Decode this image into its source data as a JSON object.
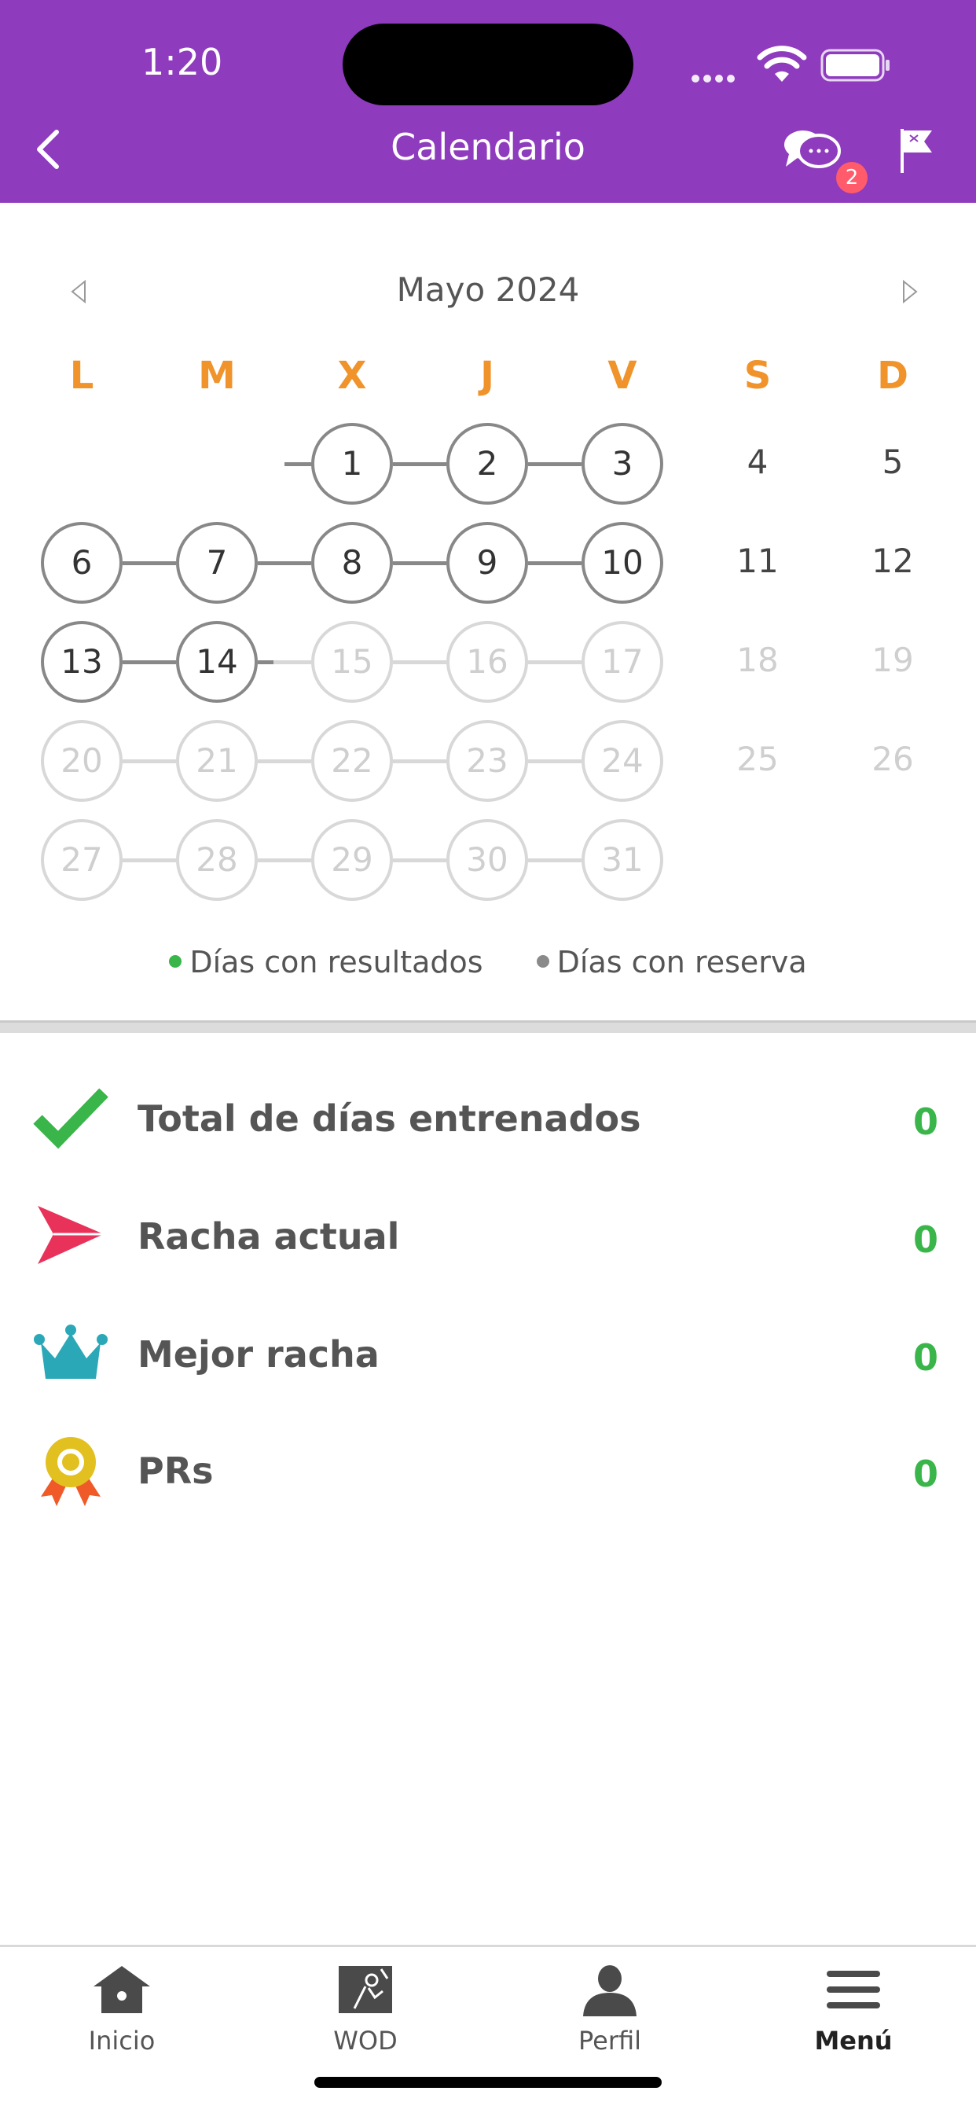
{
  "status_bar": {
    "time": "1:20"
  },
  "header": {
    "title": "Calendario",
    "chat_badge": "2"
  },
  "calendar": {
    "month": "Mayo 2024",
    "weekdays": [
      "L",
      "M",
      "X",
      "J",
      "V",
      "S",
      "D"
    ],
    "weeks": [
      [
        "",
        "",
        "1",
        "2",
        "3",
        "4",
        "5"
      ],
      [
        "6",
        "7",
        "8",
        "9",
        "10",
        "11",
        "12"
      ],
      [
        "13",
        "14",
        "15",
        "16",
        "17",
        "18",
        "19"
      ],
      [
        "20",
        "21",
        "22",
        "23",
        "24",
        "25",
        "26"
      ],
      [
        "27",
        "28",
        "29",
        "30",
        "31",
        "",
        ""
      ]
    ],
    "reserved_days": [
      "1",
      "2",
      "3",
      "6",
      "7",
      "8",
      "9",
      "10",
      "13",
      "14"
    ],
    "upcoming_days": [
      "15",
      "16",
      "17",
      "20",
      "21",
      "22",
      "23",
      "24",
      "27",
      "28",
      "29",
      "30",
      "31"
    ],
    "weekend_past": [
      "4",
      "5",
      "11",
      "12"
    ],
    "weekend_future": [
      "18",
      "19",
      "25",
      "26"
    ],
    "legend": [
      {
        "label": "Días con resultados",
        "color": "#39b549"
      },
      {
        "label": "Días con reserva",
        "color": "#8a8a8a"
      }
    ]
  },
  "stats": [
    {
      "label": "Total de días entrenados",
      "value": "0",
      "icon": "check-icon"
    },
    {
      "label": "Racha actual",
      "value": "0",
      "icon": "paper-plane-icon"
    },
    {
      "label": "Mejor racha",
      "value": "0",
      "icon": "crown-icon"
    },
    {
      "label": "PRs",
      "value": "0",
      "icon": "medal-icon"
    }
  ],
  "tabbar": [
    {
      "label": "Inicio",
      "icon": "home-icon"
    },
    {
      "label": "WOD",
      "icon": "wod-icon"
    },
    {
      "label": "Perfil",
      "icon": "profile-icon"
    },
    {
      "label": "Menú",
      "icon": "menu-icon"
    }
  ],
  "colors": {
    "header": "#8e3bbd",
    "weekday": "#f0932b",
    "value": "#39b549"
  }
}
